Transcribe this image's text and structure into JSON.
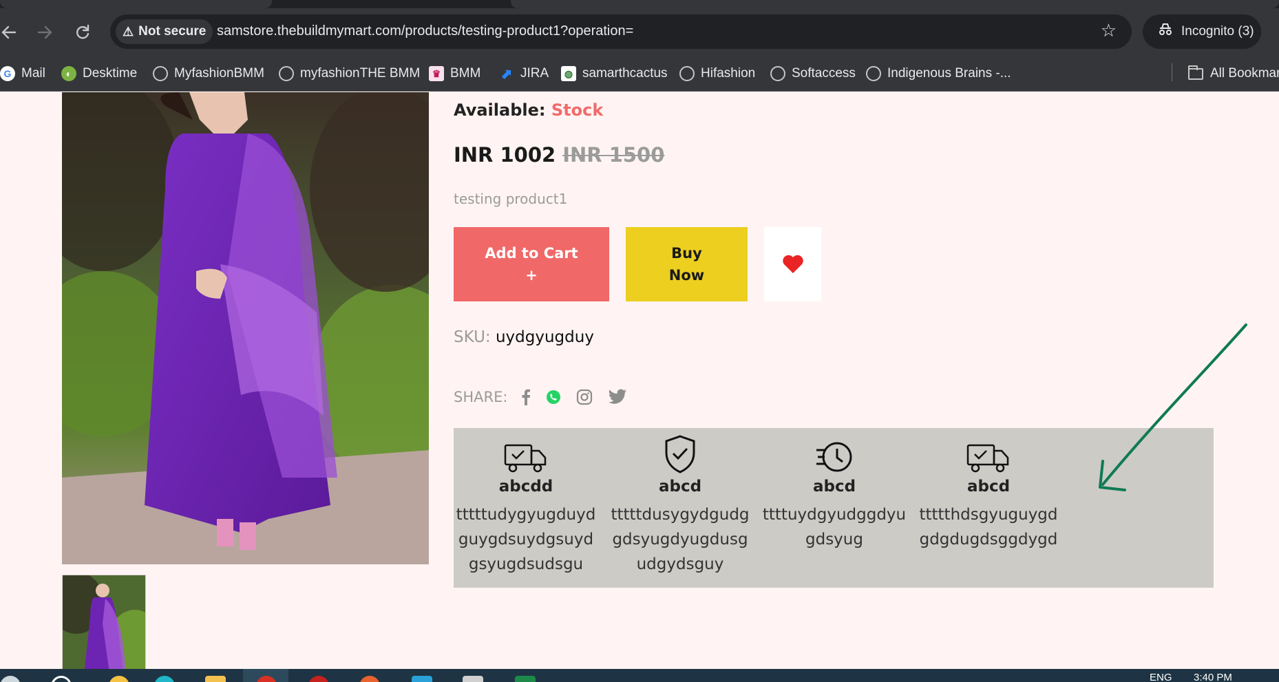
{
  "browser": {
    "security_label": "Not secure",
    "url": "samstore.thebuildmymart.com/products/testing-product1?operation=",
    "incognito_label": "Incognito (3)",
    "bookmarks": [
      {
        "label": "Mail",
        "icon": "google-icon"
      },
      {
        "label": "Desktime",
        "icon": "desktime-icon"
      },
      {
        "label": "MyfashionBMM",
        "icon": "globe-icon"
      },
      {
        "label": "myfashionTHE BMM",
        "icon": "globe-icon"
      },
      {
        "label": "BMM",
        "icon": "bmm-icon"
      },
      {
        "label": "JIRA",
        "icon": "jira-icon"
      },
      {
        "label": "samarthcactus",
        "icon": "cactus-icon"
      },
      {
        "label": "Hifashion",
        "icon": "globe-icon"
      },
      {
        "label": "Softaccess",
        "icon": "globe-icon"
      },
      {
        "label": "Indigenous Brains -...",
        "icon": "globe-icon"
      }
    ],
    "all_bookmarks_label": "All Bookmar"
  },
  "product": {
    "availability_label": "Available:",
    "availability_value": "Stock",
    "price_current": "INR 1002",
    "price_original": "INR 1500",
    "description": "testing product1",
    "add_to_cart_line1": "Add to Cart",
    "add_to_cart_line2": "+",
    "buy_now_line1": "Buy",
    "buy_now_line2": "Now",
    "sku_label": "SKU:",
    "sku_value": "uydgyugduy",
    "share_label": "SHARE:",
    "share_icons": [
      "facebook-icon",
      "whatsapp-icon",
      "instagram-icon",
      "twitter-icon"
    ]
  },
  "features": [
    {
      "icon": "delivery-truck-icon",
      "title": "abcdd",
      "text": "tttttudygyugduydguygdsuydgsuydgsyugdsudsgu"
    },
    {
      "icon": "shield-check-icon",
      "title": "abcd",
      "text": "tttttdusygydgudggdsyugdyugdusgudgydsguy"
    },
    {
      "icon": "history-clock-icon",
      "title": "abcd",
      "text": "ttttuydgyudggdyugdsyug"
    },
    {
      "icon": "delivery-truck-icon",
      "title": "abcd",
      "text": "ttttthdsgyuguygdgdgdugdsggdygd"
    }
  ],
  "taskbar": {
    "language": "ENG",
    "time": "3:40 PM"
  },
  "colors": {
    "page_bg": "#fff4f3",
    "stock": "#f06b6b",
    "add_to_cart": "#f06868",
    "buy_now": "#eccf1f",
    "features_bg": "#cccbc6",
    "annotation_arrow": "#0f7a55"
  }
}
